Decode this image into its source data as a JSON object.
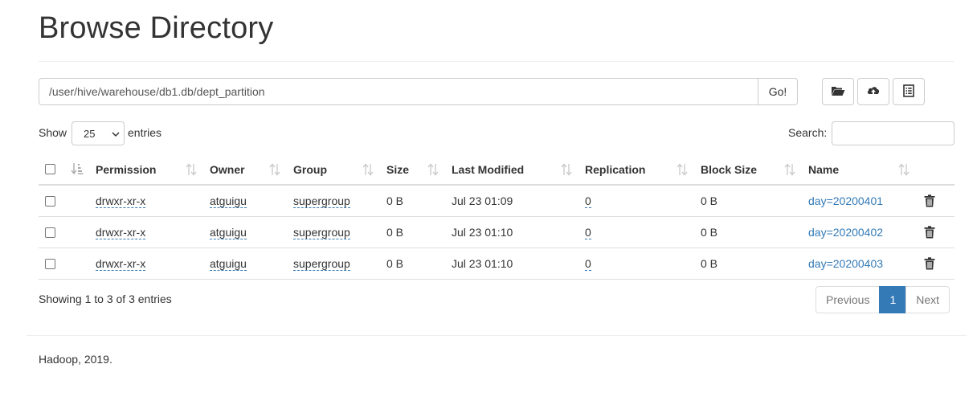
{
  "page": {
    "title": "Browse Directory"
  },
  "path_bar": {
    "value": "/user/hive/warehouse/db1.db/dept_partition",
    "go_label": "Go!"
  },
  "toolbar": {
    "icons": [
      "folder-open-icon",
      "cloud-upload-icon",
      "list-alt-icon"
    ]
  },
  "length_menu": {
    "show_label": "Show",
    "selected": "25",
    "entries_label": "entries"
  },
  "search": {
    "label": "Search:",
    "value": ""
  },
  "table": {
    "columns": [
      "Permission",
      "Owner",
      "Group",
      "Size",
      "Last Modified",
      "Replication",
      "Block Size",
      "Name"
    ],
    "rows": [
      {
        "permission": "drwxr-xr-x",
        "owner": "atguigu",
        "group": "supergroup",
        "size": "0 B",
        "modified": "Jul 23 01:09",
        "replication": "0",
        "block_size": "0 B",
        "name": "day=20200401"
      },
      {
        "permission": "drwxr-xr-x",
        "owner": "atguigu",
        "group": "supergroup",
        "size": "0 B",
        "modified": "Jul 23 01:10",
        "replication": "0",
        "block_size": "0 B",
        "name": "day=20200402"
      },
      {
        "permission": "drwxr-xr-x",
        "owner": "atguigu",
        "group": "supergroup",
        "size": "0 B",
        "modified": "Jul 23 01:10",
        "replication": "0",
        "block_size": "0 B",
        "name": "day=20200403"
      }
    ]
  },
  "info": {
    "text": "Showing 1 to 3 of 3 entries"
  },
  "pagination": {
    "previous": "Previous",
    "current": "1",
    "next": "Next"
  },
  "footer": {
    "text": "Hadoop, 2019."
  },
  "colors": {
    "link": "#337ab7",
    "active_page": "#337ab7",
    "border": "#dddddd"
  }
}
